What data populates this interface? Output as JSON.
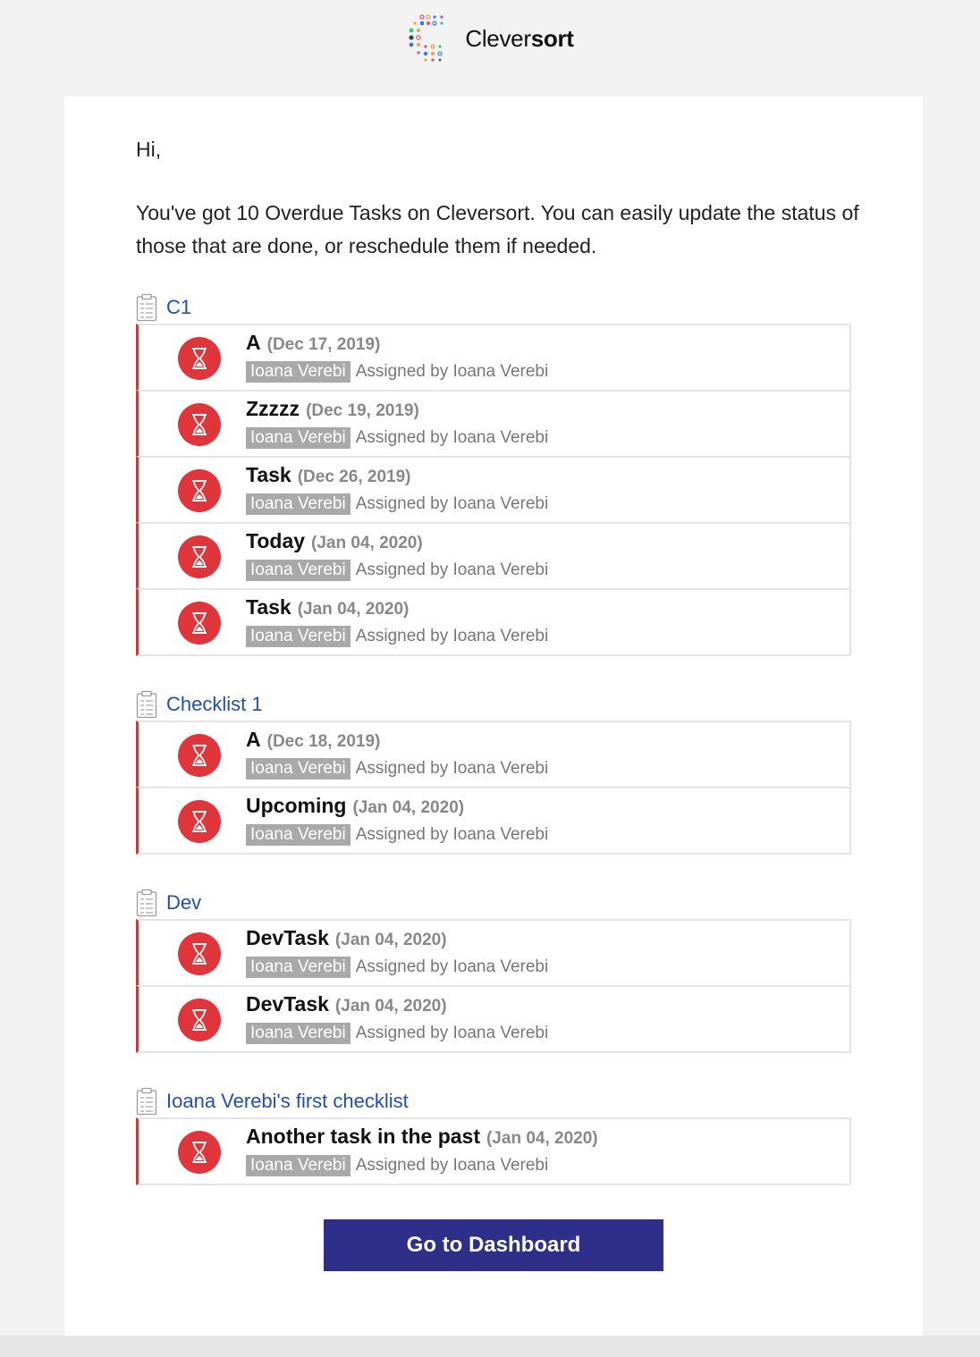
{
  "brand": {
    "name_regular": "Clever",
    "name_bold": "sort"
  },
  "email": {
    "greeting": "Hi,",
    "intro": "You've got 10 Overdue Tasks on Cleversort. You can easily update the status of those that are done, or reschedule them if needed.",
    "button_label": "Go to Dashboard"
  },
  "colors": {
    "overdue_red": "#e0353a",
    "group_link_blue": "#1f4fb6",
    "button_navy": "#2d2f89"
  },
  "icons": {
    "group": "clipboard-icon",
    "task": "hourglass-icon"
  },
  "groups": [
    {
      "name": "C1",
      "tasks": [
        {
          "name": "A",
          "date": "(Dec 17, 2019)",
          "assignee": "Ioana Verebi",
          "assigned_by": "Assigned by Ioana Verebi"
        },
        {
          "name": "Zzzzz",
          "date": "(Dec 19, 2019)",
          "assignee": "Ioana Verebi",
          "assigned_by": "Assigned by Ioana Verebi"
        },
        {
          "name": "Task",
          "date": "(Dec 26, 2019)",
          "assignee": "Ioana Verebi",
          "assigned_by": "Assigned by Ioana Verebi"
        },
        {
          "name": "Today",
          "date": "(Jan 04, 2020)",
          "assignee": "Ioana Verebi",
          "assigned_by": "Assigned by Ioana Verebi"
        },
        {
          "name": "Task",
          "date": "(Jan 04, 2020)",
          "assignee": "Ioana Verebi",
          "assigned_by": "Assigned by Ioana Verebi"
        }
      ]
    },
    {
      "name": "Checklist 1",
      "tasks": [
        {
          "name": "A",
          "date": "(Dec 18, 2019)",
          "assignee": "Ioana Verebi",
          "assigned_by": "Assigned by Ioana Verebi"
        },
        {
          "name": "Upcoming",
          "date": "(Jan 04, 2020)",
          "assignee": "Ioana Verebi",
          "assigned_by": "Assigned by Ioana Verebi"
        }
      ]
    },
    {
      "name": "Dev",
      "tasks": [
        {
          "name": "DevTask",
          "date": "(Jan 04, 2020)",
          "assignee": "Ioana Verebi",
          "assigned_by": "Assigned by Ioana Verebi"
        },
        {
          "name": "DevTask",
          "date": "(Jan 04, 2020)",
          "assignee": "Ioana Verebi",
          "assigned_by": "Assigned by Ioana Verebi"
        }
      ]
    },
    {
      "name": "Ioana Verebi's first checklist",
      "tasks": [
        {
          "name": "Another task in the past",
          "date": "(Jan 04, 2020)",
          "assignee": "Ioana Verebi",
          "assigned_by": "Assigned by Ioana Verebi"
        }
      ]
    }
  ]
}
